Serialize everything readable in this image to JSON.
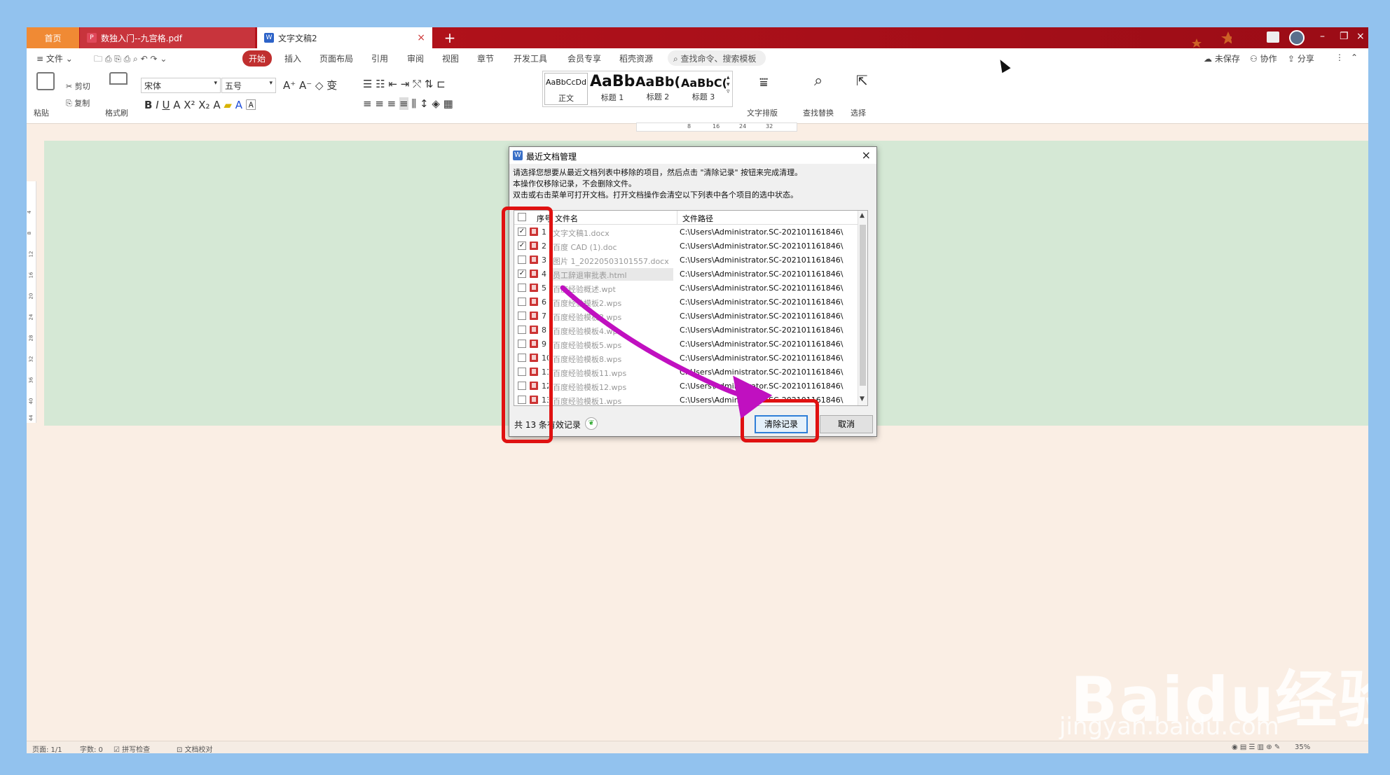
{
  "tabs": {
    "home": "首页",
    "pdf": "数独入门--九宫格.pdf",
    "doc": "文字文稿2",
    "add": "+",
    "close": "×"
  },
  "window_buttons": {
    "min": "–",
    "restore": "❐",
    "close": "×"
  },
  "menu": {
    "file": "文件",
    "items": [
      "开始",
      "插入",
      "页面布局",
      "引用",
      "审阅",
      "视图",
      "章节",
      "开发工具",
      "会员专享",
      "稻壳资源"
    ],
    "search": "查找命令、搜索模板",
    "right": {
      "unsaved": "未保存",
      "collab": "协作",
      "share": "分享"
    }
  },
  "ribbon": {
    "paste": "粘贴",
    "cut": "剪切",
    "copy": "复制",
    "format_painter": "格式刷",
    "font": "宋体",
    "size": "五号",
    "styles": [
      {
        "sample": "AaBbCcDd",
        "name": "正文"
      },
      {
        "sample": "AaBb",
        "name": "标题 1"
      },
      {
        "sample": "AaBb(",
        "name": "标题 2"
      },
      {
        "sample": "AaBbC(",
        "name": "标题 3"
      }
    ],
    "text_layout": "文字排版",
    "find_replace": "查找替换",
    "select": "选择"
  },
  "ruler": {
    "ticks": [
      "8",
      "16",
      "24",
      "32"
    ]
  },
  "left_ruler": [
    "4",
    "8",
    "12",
    "16",
    "20",
    "24",
    "28",
    "32",
    "36",
    "40",
    "44"
  ],
  "dialog": {
    "title": "最近文档管理",
    "close": "×",
    "desc1": "请选择您想要从最近文档列表中移除的项目，然后点击 \"清除记录\" 按钮来完成清理。",
    "desc2": "本操作仅移除记录，不会删除文件。",
    "desc3": "双击或右击菜单可打开文档。打开文档操作会清空以下列表中各个项目的选中状态。",
    "col_num": "序号",
    "col_name": "文件名",
    "col_path": "文件路径",
    "rows": [
      {
        "checked": true,
        "num": "1",
        "name": "文字文稿1.docx",
        "path": "C:\\Users\\Administrator.SC-202101161846\\"
      },
      {
        "checked": true,
        "num": "2",
        "name": "百度 CAD  (1).doc",
        "path": "C:\\Users\\Administrator.SC-202101161846\\"
      },
      {
        "checked": false,
        "num": "3",
        "name": "图片 1_20220503101557.docx",
        "path": "C:\\Users\\Administrator.SC-202101161846\\"
      },
      {
        "checked": true,
        "num": "4",
        "name": "员工辞退审批表.html",
        "path": "C:\\Users\\Administrator.SC-202101161846\\"
      },
      {
        "checked": false,
        "num": "5",
        "name": "百度经验概述.wpt",
        "path": "C:\\Users\\Administrator.SC-202101161846\\"
      },
      {
        "checked": false,
        "num": "6",
        "name": "百度经验模板2.wps",
        "path": "C:\\Users\\Administrator.SC-202101161846\\"
      },
      {
        "checked": false,
        "num": "7",
        "name": "百度经验模板3.wps",
        "path": "C:\\Users\\Administrator.SC-202101161846\\"
      },
      {
        "checked": false,
        "num": "8",
        "name": "百度经验模板4.wps",
        "path": "C:\\Users\\Administrator.SC-202101161846\\"
      },
      {
        "checked": false,
        "num": "9",
        "name": "百度经验模板5.wps",
        "path": "C:\\Users\\Administrator.SC-202101161846\\"
      },
      {
        "checked": false,
        "num": "10",
        "name": "百度经验模板8.wps",
        "path": "C:\\Users\\Administrator.SC-202101161846\\"
      },
      {
        "checked": false,
        "num": "11",
        "name": "百度经验模板11.wps",
        "path": "C:\\Users\\Administrator.SC-202101161846\\"
      },
      {
        "checked": false,
        "num": "12",
        "name": "百度经验模板12.wps",
        "path": "C:\\Users\\Administrator.SC-202101161846\\"
      },
      {
        "checked": false,
        "num": "13",
        "name": "百度经验模板1.wps",
        "path": "C:\\Users\\Administrator.SC-202101161846\\"
      }
    ],
    "count": "共 13 条有效记录",
    "clear_button": "清除记录",
    "cancel_button": "取消"
  },
  "status": {
    "page": "页面: 1/1",
    "words": "字数: 0",
    "spell": "拼写检查",
    "check": "文档校对",
    "zoom": "35%"
  },
  "watermark": {
    "brand": "Baidu经验",
    "url": "jingyan.baidu.com"
  },
  "colors": {
    "accent": "#c02f2f",
    "annotation_red": "#e01111",
    "arrow_magenta": "#c010c0",
    "green_band": "#d5e8d5"
  }
}
